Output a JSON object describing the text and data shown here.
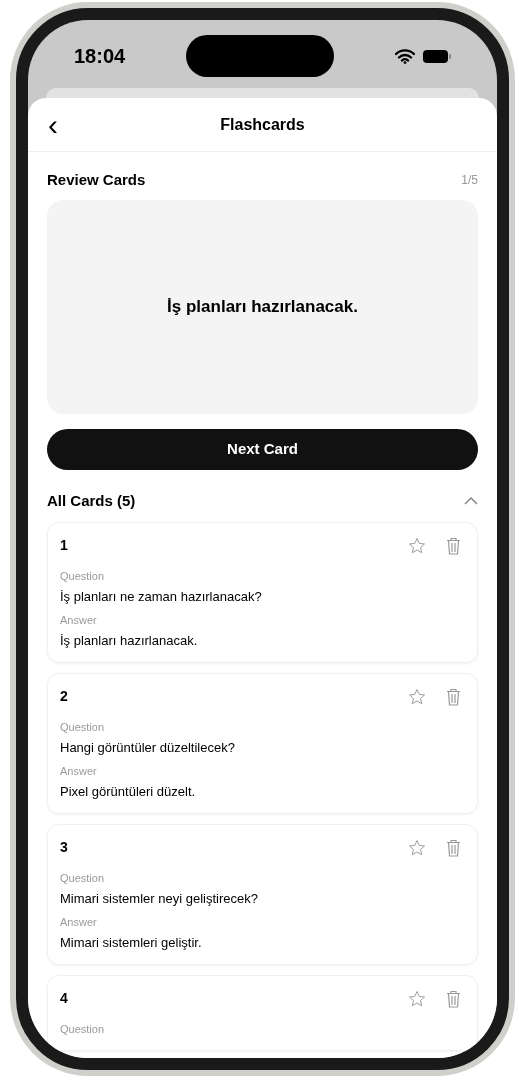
{
  "status_bar": {
    "time": "18:04"
  },
  "header": {
    "back": "‹",
    "title": "Flashcards"
  },
  "review": {
    "title": "Review Cards",
    "counter": "1/5",
    "card_text": "İş planları hazırlanacak.",
    "next_button": "Next Card"
  },
  "all_cards": {
    "title": "All Cards (5)",
    "expanded": true,
    "cards": [
      {
        "number": "1",
        "starred": false,
        "question_label": "Question",
        "question": "İş planları ne zaman hazırlanacak?",
        "answer_label": "Answer",
        "answer": "İş planları hazırlanacak."
      },
      {
        "number": "2",
        "starred": false,
        "question_label": "Question",
        "question": "Hangi görüntüler düzeltilecek?",
        "answer_label": "Answer",
        "answer": "Pixel görüntüleri düzelt."
      },
      {
        "number": "3",
        "starred": false,
        "question_label": "Question",
        "question": "Mimari sistemler neyi geliştirecek?",
        "answer_label": "Answer",
        "answer": "Mimari sistemleri geliştir."
      },
      {
        "number": "4",
        "starred": false,
        "question_label": "Question"
      }
    ]
  }
}
